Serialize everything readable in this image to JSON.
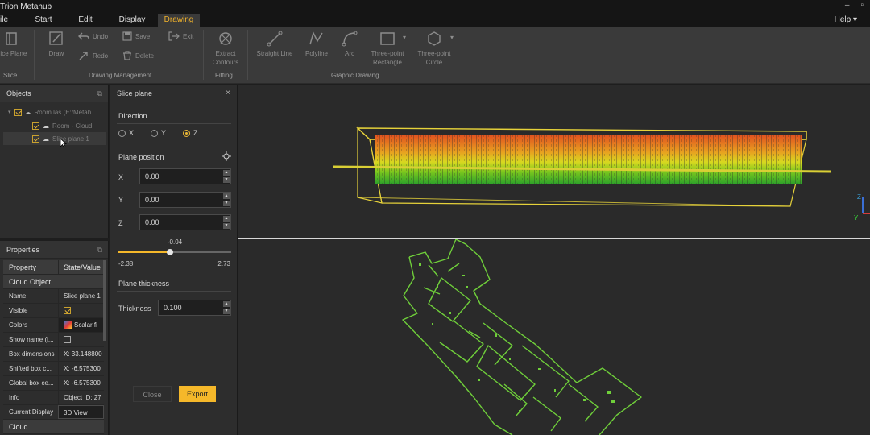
{
  "app": {
    "title": "Trion Metahub",
    "window_min": "–",
    "window_restore": "▫"
  },
  "menu": {
    "tabs": [
      {
        "label": "ile"
      },
      {
        "label": "Start"
      },
      {
        "label": "Edit"
      },
      {
        "label": "Display"
      },
      {
        "label": "Drawing"
      }
    ],
    "help": "Help ▾"
  },
  "ribbon": {
    "slice_plane": "lice Plane",
    "draw": "Draw",
    "undo": "Undo",
    "save": "Save",
    "exit": "Exit",
    "redo": "Redo",
    "delete": "Delete",
    "extract_contours": "Extract Contours",
    "straight_line": "Straight Line",
    "polyline": "Polyline",
    "arc": "Arc",
    "three_point_rectangle": "Three-point Rectangle",
    "three_point_circle": "Three-point Circle",
    "groups": {
      "slice": "Slice",
      "drawing_management": "Drawing Management",
      "fitting": "Fitting",
      "graphic_drawing": "Graphic Drawing"
    }
  },
  "objects": {
    "title": "Objects",
    "tree": [
      {
        "label": "Room.las (E:/Metah..."
      },
      {
        "label": "Room - Cloud"
      },
      {
        "label": "Slice plane 1"
      }
    ]
  },
  "properties": {
    "title": "Properties",
    "columns": [
      "Property",
      "State/Value"
    ],
    "section_cloud_object": "Cloud Object",
    "rows": [
      {
        "k": "Name",
        "v": "Slice plane 1"
      },
      {
        "k": "Visible",
        "v": ""
      },
      {
        "k": "Colors",
        "v": "Scalar fi"
      },
      {
        "k": "Show name (i...",
        "v": ""
      },
      {
        "k": "Box dimensions",
        "v": "X: 33.148800"
      },
      {
        "k": "Shifted box c...",
        "v": "X: -6.575300"
      },
      {
        "k": "Global box ce...",
        "v": "X: -6.575300"
      },
      {
        "k": "Info",
        "v": "Object ID: 27"
      },
      {
        "k": "Current Display",
        "v": "3D View"
      }
    ],
    "section_cloud": "Cloud"
  },
  "slice": {
    "title": "Slice plane",
    "close_x": "×",
    "direction_title": "Direction",
    "direction_options": [
      "X",
      "Y",
      "Z"
    ],
    "direction_selected": "Z",
    "position_title": "Plane position",
    "x_label": "X",
    "x_value": "0.00",
    "y_label": "Y",
    "y_value": "0.00",
    "z_label": "Z",
    "z_value": "0.00",
    "slider_value": "-0.04",
    "slider_min": "-2.38",
    "slider_max": "2.73",
    "slider_fraction": 0.458,
    "thickness_title": "Plane thickness",
    "thickness_label": "Thickness",
    "thickness_value": "0.100",
    "close_button": "Close",
    "export_button": "Export"
  },
  "colors": {
    "accent": "#f5b82a",
    "active_tab_text": "#f2b32b",
    "bbox": "#e6d23a",
    "floorplan": "#6fcf3a"
  },
  "viewport": {
    "axis_z": "Z",
    "axis_y": "Y"
  }
}
